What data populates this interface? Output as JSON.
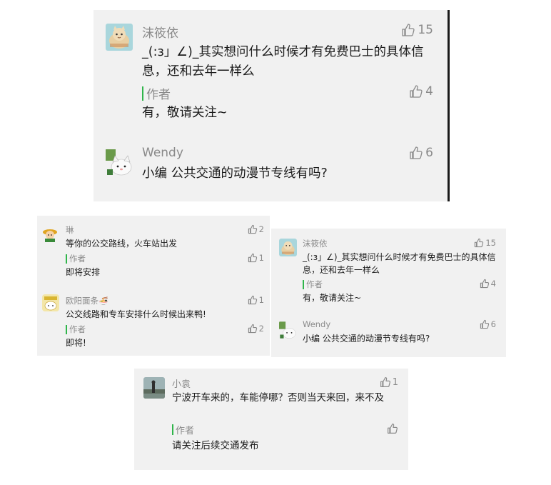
{
  "panel_top": {
    "comment1": {
      "name": "沫筱依",
      "likes": "15",
      "text": "_(:з」∠)_其实想问什么时候才有免费巴士的具体信息，还和去年一样么",
      "author_label": "作者",
      "author_likes": "4",
      "author_reply": "有，敬请关注~"
    },
    "comment2": {
      "name": "Wendy",
      "likes": "6",
      "text": "小编 公共交通的动漫节专线有吗?"
    }
  },
  "panel_left": {
    "comment1": {
      "name": "琳",
      "likes": "2",
      "text": "等你的公交路线，火车站出发",
      "author_label": "作者",
      "author_likes": "1",
      "author_reply": "即将安排"
    },
    "comment2": {
      "name": "欧阳面条",
      "name_emoji": "🍜",
      "likes": "1",
      "text": "公交线路和专车安排什么时候出来鸭!",
      "author_label": "作者",
      "author_likes": "2",
      "author_reply": "即将!"
    }
  },
  "panel_right": {
    "comment1": {
      "name": "沫筱依",
      "likes": "15",
      "text": "_(:з」∠)_其实想问什么时候才有免费巴士的具体信息，还和去年一样么",
      "author_label": "作者",
      "author_likes": "4",
      "author_reply": "有，敬请关注~"
    },
    "comment2": {
      "name": "Wendy",
      "likes": "6",
      "text": "小编 公共交通的动漫节专线有吗?"
    }
  },
  "panel_bottom": {
    "comment1": {
      "name": "小袁",
      "likes": "1",
      "text": "宁波开车来的，车能停哪？否则当天来回，来不及",
      "author_label": "作者",
      "author_likes": "",
      "author_reply": "请关注后续交通发布"
    }
  },
  "colors": {
    "panel_bg": "#f1f1f1",
    "meta_gray": "#8a8a8a",
    "author_bar": "#2fb54a",
    "text": "#1c1c1c"
  },
  "icons": {
    "like": "thumbs-up-icon",
    "avatars": [
      "cat-avatar-icon",
      "cat-avatar-icon",
      "boy-avatar-icon",
      "sticker-avatar-icon",
      "photo-avatar-icon"
    ]
  }
}
